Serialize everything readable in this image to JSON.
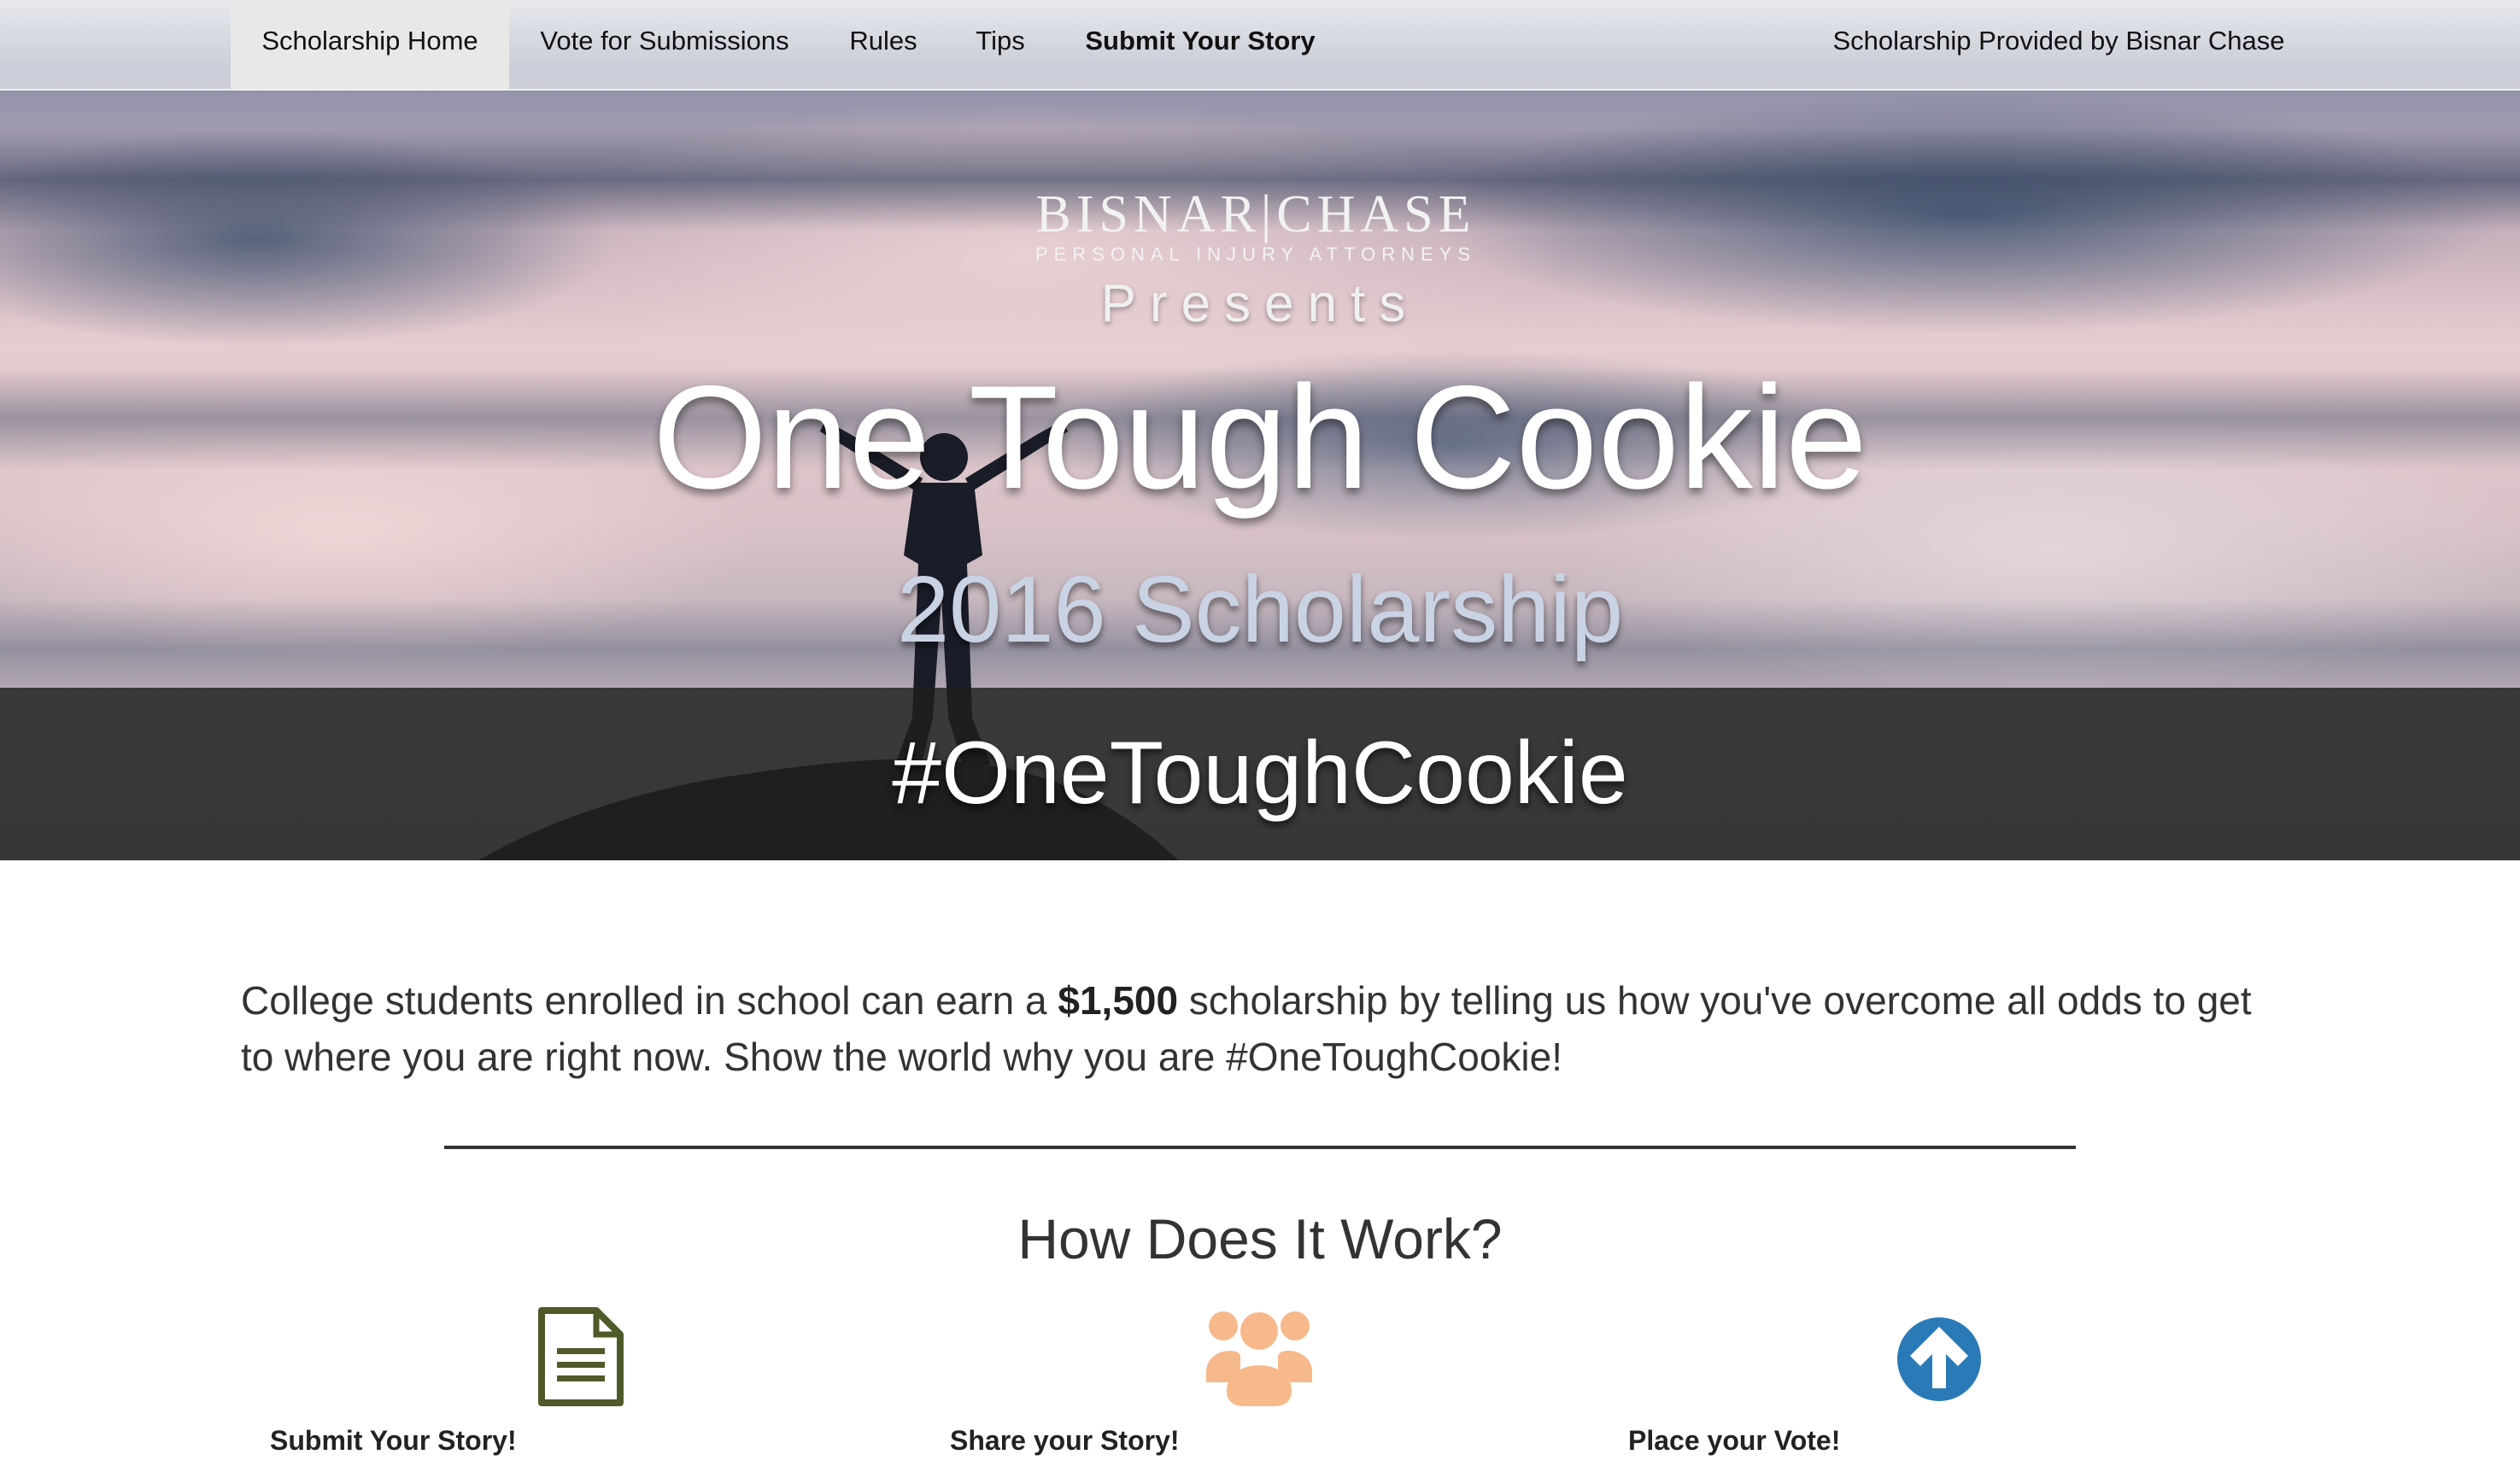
{
  "nav": {
    "items": [
      {
        "label": "Scholarship Home"
      },
      {
        "label": "Vote for Submissions"
      },
      {
        "label": "Rules"
      },
      {
        "label": "Tips"
      },
      {
        "label": "Submit Your Story"
      }
    ],
    "provider": "Scholarship Provided by Bisnar Chase"
  },
  "hero": {
    "logo_name": "BISNAR|CHASE",
    "logo_sub": "PERSONAL INJURY ATTORNEYS",
    "presents": "Presents",
    "title": "One Tough Cookie",
    "subtitle": "2016 Scholarship",
    "hashtag": "#OneToughCookie"
  },
  "intro": {
    "before": "College students enrolled in school can earn a ",
    "amount": "$1,500",
    "after": " scholarship by telling us how you've overcome all odds to get to where you are right now. Show the world why you are #OneToughCookie!"
  },
  "how_it_works": {
    "heading": "How Does It Work?",
    "steps": [
      {
        "label": "Submit Your Story!",
        "icon": "document-icon",
        "color": "#4f5a2a"
      },
      {
        "label": "Share your Story!",
        "icon": "group-icon",
        "color": "#f7b98b"
      },
      {
        "label": "Place your Vote!",
        "icon": "arrow-up-circle-icon",
        "color": "#2a7ab8"
      }
    ]
  }
}
